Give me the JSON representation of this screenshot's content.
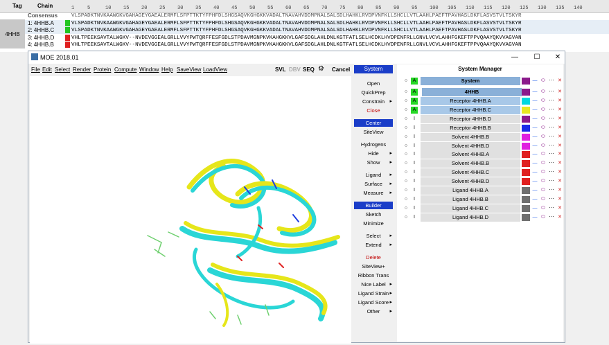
{
  "sequence_panel": {
    "tag_header": "Tag",
    "chain_header": "Chain",
    "pdb_tag": "4HHB",
    "ruler": [
      "1",
      "5",
      "10",
      "15",
      "20",
      "25",
      "30",
      "35",
      "40",
      "45",
      "50",
      "55",
      "60",
      "65",
      "70",
      "75",
      "80",
      "85",
      "90",
      "95",
      "100",
      "105",
      "110",
      "115",
      "120",
      "125",
      "130",
      "135",
      "140"
    ],
    "rows": [
      {
        "label": "Consensus",
        "seq": "VLSPADKTNVKAAWGKVGAHAGEYGAEALERMFLSFPTTKTYFPHFDLSHGSAQVKGHGKKVADALTNAVAHVDDMPNALSALSDLHAHKLRVDPVNFKLLSHCLLVTLAAHLPAEFTPAVHASLDKFLASVSTVLTSKYR",
        "color": "#555",
        "mark": ""
      },
      {
        "label": "1: 4HHB.A",
        "seq": "VLSPADKTNVKAAWGKVGAHAGEYGAEALERMFLSFPTTKTYFPHFDLSHGSAQVKGHGKKVADALTNAVAHVDDMPNALSALSDLHAHKLRVDPVNFKLLSHCLLVTLAAHLPAEFTPAVHASLDKFLASVSTVLTSKYR",
        "color": "#000",
        "mark": "#22c622"
      },
      {
        "label": "2: 4HHB.C",
        "seq": "VLSPADKTNVKAAWGKVGAHAGEYGAEALERMFLSFPTTKTYFPHFDLSHGSAQVKGHGKKVADALTNAVAHVDDMPNALSALSDLHAHKLRVDPVNFKLLSHCLLVTLAAHLPAEFTPAVHASLDKFLASVSTVLTSKYR",
        "color": "#000",
        "mark": "#22c622"
      },
      {
        "label": "3: 4HHB.D",
        "seq": "VHLTPEEKSAVTALWGKV--NVDEVGGEALGRLLVVYPWTQRFFESFGDLSTPDAVMGNPKVKAHGKKVLGAFSDGLAHLDNLKGTFATLSELHCDKLHVDPENFRLLGNVLVCVLAHHFGKEFTPPVQAAYQKVVAGVAN",
        "color": "#000",
        "mark": "#e02020"
      },
      {
        "label": "4: 4HHB.B",
        "seq": "VHLTPEEKSAVTALWGKV--NVDEVGGEALGRLLVVYPWTQRFFESFGDLSTPDAVMGNPKVKAHGKKVLGAFSDGLAHLDNLKGTFATLSELHCDKLHVDPENFRLLGNVLVCVLAHHFGKEFTPPVQAAYQKVVAGVAN",
        "color": "#000",
        "mark": "#e02020"
      }
    ]
  },
  "window": {
    "title": "MOE 2018.01",
    "minimize": "—",
    "maximize": "☐",
    "close": "✕",
    "menu": [
      "File",
      "Edit",
      "Select",
      "Render",
      "Protein",
      "Compute",
      "Window",
      "Help",
      "SaveView",
      "LoadView"
    ],
    "right_tools": {
      "svl": "SVL",
      "dbv": "DBV",
      "seq": "SEQ",
      "cancel": "Cancel"
    },
    "system_button": "System",
    "side_buttons": [
      {
        "label": "Open",
        "style": ""
      },
      {
        "label": "QuickPrep",
        "style": ""
      },
      {
        "label": "Constrain",
        "style": "arrow"
      },
      {
        "label": "Close",
        "style": "red"
      },
      {
        "label": "Center",
        "style": "blue"
      },
      {
        "label": "SiteView",
        "style": ""
      },
      {
        "label": "Hydrogens",
        "style": ""
      },
      {
        "label": "Hide",
        "style": "arrow"
      },
      {
        "label": "Show",
        "style": "arrow"
      },
      {
        "label": "Ligand",
        "style": "arrow"
      },
      {
        "label": "Surface",
        "style": "arrow"
      },
      {
        "label": "Measure",
        "style": "arrow"
      },
      {
        "label": "Builder",
        "style": "blue"
      },
      {
        "label": "Sketch",
        "style": ""
      },
      {
        "label": "Minimize",
        "style": ""
      },
      {
        "label": "Select",
        "style": "arrow"
      },
      {
        "label": "Extend",
        "style": "arrow"
      },
      {
        "label": "Delete",
        "style": "red"
      },
      {
        "label": "SiteView+",
        "style": ""
      },
      {
        "label": "Ribbon Trans",
        "style": ""
      },
      {
        "label": "Nice Label",
        "style": "arrow"
      },
      {
        "label": "Ligand Strain",
        "style": "arrow"
      },
      {
        "label": "Ligand Score",
        "style": "arrow"
      },
      {
        "label": "Other",
        "style": "arrow"
      }
    ]
  },
  "system_manager": {
    "title": "System Manager",
    "header_row": {
      "label": "System",
      "color": "#8b1a8b"
    },
    "group_row": {
      "label": "4HHB",
      "color": "#8b1a8b"
    },
    "entries": [
      {
        "label": "Receptor 4HHB.A",
        "kind": "A",
        "color": "#00d8e0",
        "active": true
      },
      {
        "label": "Receptor 4HHB.C",
        "kind": "A",
        "color": "#e8e820",
        "active": true
      },
      {
        "label": "Receptor 4HHB.D",
        "kind": "I",
        "color": "#8b1a8b",
        "active": false
      },
      {
        "label": "Receptor 4HHB.B",
        "kind": "I",
        "color": "#1a2ae8",
        "active": false
      },
      {
        "label": "Solvent 4HHB.B",
        "kind": "I",
        "color": "#e020e0",
        "active": false
      },
      {
        "label": "Solvent 4HHB.D",
        "kind": "I",
        "color": "#e020e0",
        "active": false
      },
      {
        "label": "Solvent 4HHB.A",
        "kind": "I",
        "color": "#e02020",
        "active": false
      },
      {
        "label": "Solvent 4HHB.B",
        "kind": "I",
        "color": "#e02020",
        "active": false
      },
      {
        "label": "Solvent 4HHB.C",
        "kind": "I",
        "color": "#e02020",
        "active": false
      },
      {
        "label": "Solvent 4HHB.D",
        "kind": "I",
        "color": "#e02020",
        "active": false
      },
      {
        "label": "Ligand 4HHB.A",
        "kind": "I",
        "color": "#707070",
        "active": false
      },
      {
        "label": "Ligand 4HHB.B",
        "kind": "I",
        "color": "#707070",
        "active": false
      },
      {
        "label": "Ligand 4HHB.C",
        "kind": "I",
        "color": "#707070",
        "active": false
      },
      {
        "label": "Ligand 4HHB.D",
        "kind": "I",
        "color": "#707070",
        "active": false
      }
    ]
  }
}
